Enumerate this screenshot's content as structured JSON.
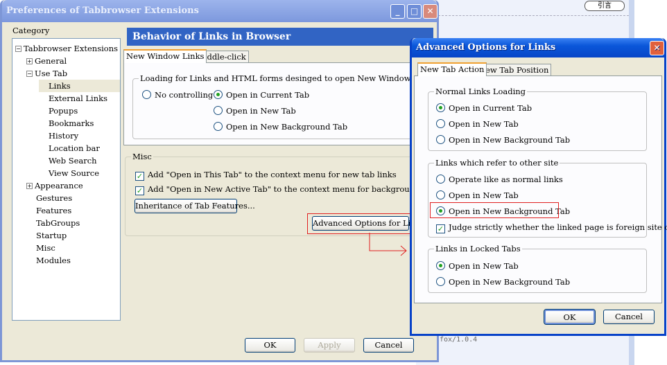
{
  "background": {
    "quote_button": "引言",
    "footer_text": "fox/1.0.4"
  },
  "main_window": {
    "title": "Preferences of Tabbrowser Extensions",
    "category_label": "Category",
    "tree": [
      {
        "label": "Tabbrowser Extensions",
        "level": 0,
        "expander": "−"
      },
      {
        "label": "General",
        "level": 1,
        "expander": "+"
      },
      {
        "label": "Use Tab",
        "level": 1,
        "expander": "−"
      },
      {
        "label": "Links",
        "level": 2,
        "selected": true
      },
      {
        "label": "External Links",
        "level": 2
      },
      {
        "label": "Popups",
        "level": 2
      },
      {
        "label": "Bookmarks",
        "level": 2
      },
      {
        "label": "History",
        "level": 2
      },
      {
        "label": "Location bar",
        "level": 2
      },
      {
        "label": "Web Search",
        "level": 2
      },
      {
        "label": "View Source",
        "level": 2
      },
      {
        "label": "Appearance",
        "level": 1,
        "expander": "+"
      },
      {
        "label": "Gestures",
        "level": 1
      },
      {
        "label": "Features",
        "level": 1
      },
      {
        "label": "TabGroups",
        "level": 1
      },
      {
        "label": "Startup",
        "level": 1
      },
      {
        "label": "Misc",
        "level": 1
      },
      {
        "label": "Modules",
        "level": 1
      }
    ],
    "header": "Behavior of Links in Browser",
    "tabs": [
      "New Window Links",
      "Middle-click"
    ],
    "group_title": "Loading for Links and HTML forms desinged to open New Window",
    "options": {
      "no_control": "No controlling",
      "current": "Open in Current Tab",
      "new": "Open in New Tab",
      "background": "Open in New Background Tab"
    },
    "misc_title": "Misc",
    "misc_checks": [
      "Add \"Open in This Tab\" to the context menu for new tab links",
      "Add \"Open in New Active Tab\" to the context menu for background tab links"
    ],
    "inherit_button": "Inheritance of Tab Features...",
    "advanced_button": "Advanced Options for Links...",
    "ok": "OK",
    "apply": "Apply",
    "cancel": "Cancel"
  },
  "advanced_dialog": {
    "title": "Advanced Options for Links",
    "tabs": [
      "New Tab Action",
      "New Tab Position"
    ],
    "normal_title": "Normal Links Loading",
    "normal_options": [
      "Open in Current Tab",
      "Open in New Tab",
      "Open in New Background Tab"
    ],
    "other_title": "Links which refer to other site",
    "other_options": [
      "Operate like as normal links",
      "Open in New Tab",
      "Open in New Background Tab"
    ],
    "judge_check": "Judge strictly whether the linked page is foreign site or not",
    "locked_title": "Links in Locked Tabs",
    "locked_options": [
      "Open in New Tab",
      "Open in New Background Tab"
    ],
    "ok": "OK",
    "cancel": "Cancel"
  },
  "colors": {
    "highlight": "#e02020",
    "title_active": "#0a56d9"
  }
}
